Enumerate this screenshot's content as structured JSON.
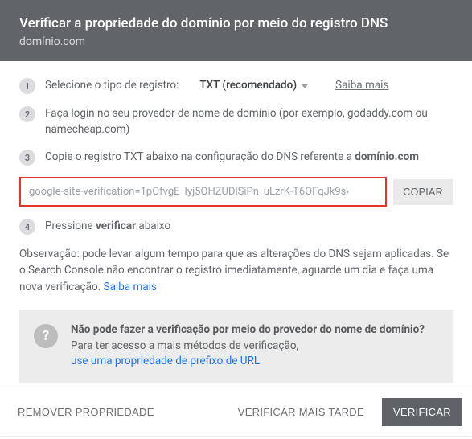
{
  "header": {
    "title": "Verificar a propriedade do domínio por meio do registro DNS",
    "domain": "domínio.com"
  },
  "steps": {
    "s1": {
      "num": "1",
      "label_prefix": "Selecione o tipo de registro:",
      "record_type": "TXT (recomendado)",
      "learn_more": "Saiba mais"
    },
    "s2": {
      "num": "2",
      "text": "Faça login no seu provedor de nome de domínio (por exemplo, godaddy.com ou namecheap.com)"
    },
    "s3": {
      "num": "3",
      "text_prefix": "Copie o registro TXT abaixo na configuração do DNS referente a ",
      "domain_bold": "domínio.com"
    },
    "s4": {
      "num": "4",
      "text_prefix": "Pressione ",
      "bold_word": "verificar",
      "text_suffix": " abaixo"
    }
  },
  "code": {
    "value": "google-site-verification=1pOfvgE_Iyj5OHZUDlSiPn_uLzrK-T6OFqJk9s›",
    "copy_label": "COPIAR"
  },
  "note": {
    "prefix": "Observação: pode levar algum tempo para que as alterações do DNS sejam aplicadas. Se o Search Console não encontrar o registro imediatamente, aguarde um dia e faça uma nova verificação. ",
    "learn_more": "Saiba mais"
  },
  "info": {
    "icon": "?",
    "title": "Não pode fazer a verificação por meio do provedor do nome de domínio?",
    "line": "Para ter acesso a mais métodos de verificação,",
    "link": "use uma propriedade de prefixo de URL"
  },
  "footer": {
    "remove": "REMOVER PROPRIEDADE",
    "later": "VERIFICAR MAIS TARDE",
    "verify": "VERIFICAR"
  }
}
